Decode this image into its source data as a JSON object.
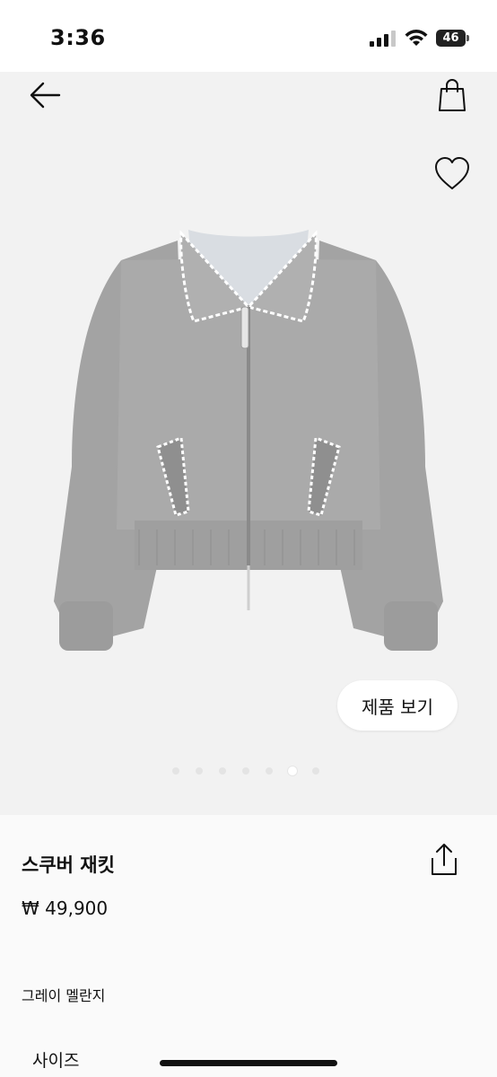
{
  "status_bar": {
    "time": "3:36",
    "battery_level": "46"
  },
  "toolbar": {
    "back_icon": "arrow-left-icon",
    "bag_icon": "shopping-bag-icon",
    "wishlist_icon": "heart-outline-icon"
  },
  "gallery": {
    "image_description_icon": "product-image",
    "view_product_label": "제품 보기",
    "page_count": 7,
    "active_page": 6
  },
  "product": {
    "name": "스쿠버 재킷",
    "price": "₩ 49,900",
    "color": "그레이 멜란지",
    "size_label": "사이즈",
    "share_icon": "share-icon"
  },
  "colors": {
    "jacket_gray": "#a9a9a9",
    "accent_white": "#ffffff",
    "background": "#f2f2f2"
  }
}
